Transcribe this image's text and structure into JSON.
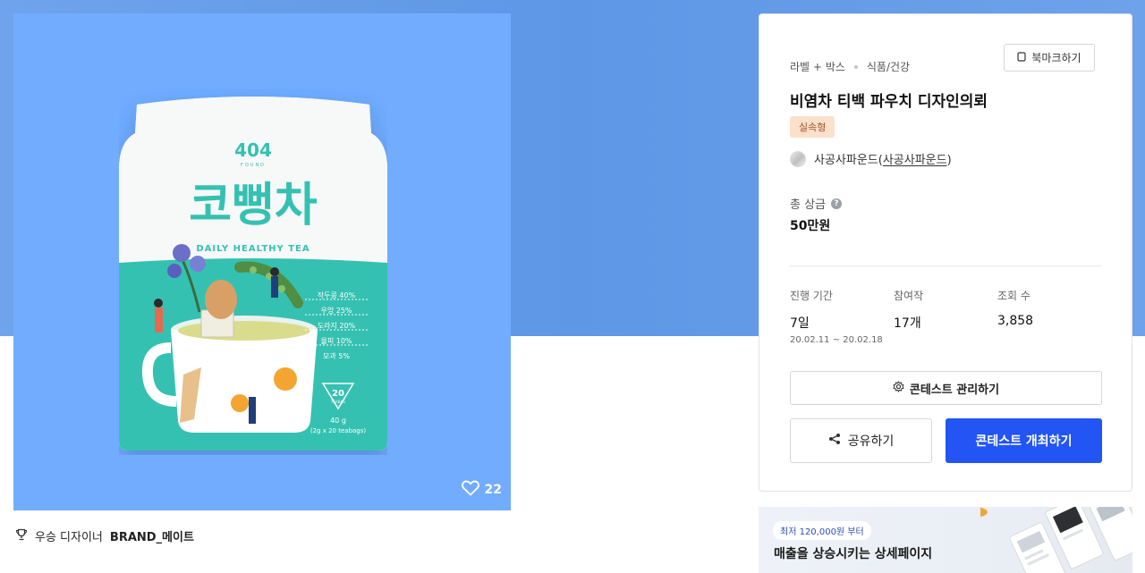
{
  "product": {
    "brand_logo": "404",
    "brand_sub": "FOUND",
    "name": "코뻥차",
    "tagline": "DAILY HEALTHY TEA",
    "ingredients": [
      "작두콩 40%",
      "우엉 25%",
      "도라지 20%",
      "율피 10%",
      "모과 5%"
    ],
    "badge_number": "20",
    "badge_text": "TEABAG",
    "weight": "40 g",
    "weight_detail": "(2g x 20 teabags)",
    "colors": {
      "teal": "#35c1b1",
      "pouch_white": "#ffffff",
      "background": "#71acff"
    }
  },
  "hero": {
    "likes_count": "22",
    "like_icon": "heart-outline-icon"
  },
  "winner": {
    "icon": "trophy-icon",
    "label": "우승 디자이너",
    "name": "BRAND_메이트"
  },
  "card": {
    "category_main": "라벨 + 박스",
    "category_sub": "식품/건강",
    "bookmark_label": "북마크하기",
    "title": "비염차 티백 파우치 디자인의뢰",
    "tag": "실속형",
    "client_name": "사공사파운드",
    "client_link": "사공사파운드",
    "prize_label": "총 상금",
    "prize_value": "50만원",
    "stats": {
      "period_label": "진행 기간",
      "period_value": "7일",
      "period_range": "20.02.11 ~ 20.02.18",
      "participants_label": "참여작",
      "participants_value": "17개",
      "views_label": "조회 수",
      "views_value": "3,858"
    },
    "manage_label": "콘테스트 관리하기",
    "share_label": "공유하기",
    "open_label": "콘테스트 개최하기",
    "accent_color": "#2255f4",
    "tag_bg": "#fbe0cb"
  },
  "ad": {
    "pill": "최저 120,000원 부터",
    "text": "매출을 상승시키는 상세페이지"
  }
}
